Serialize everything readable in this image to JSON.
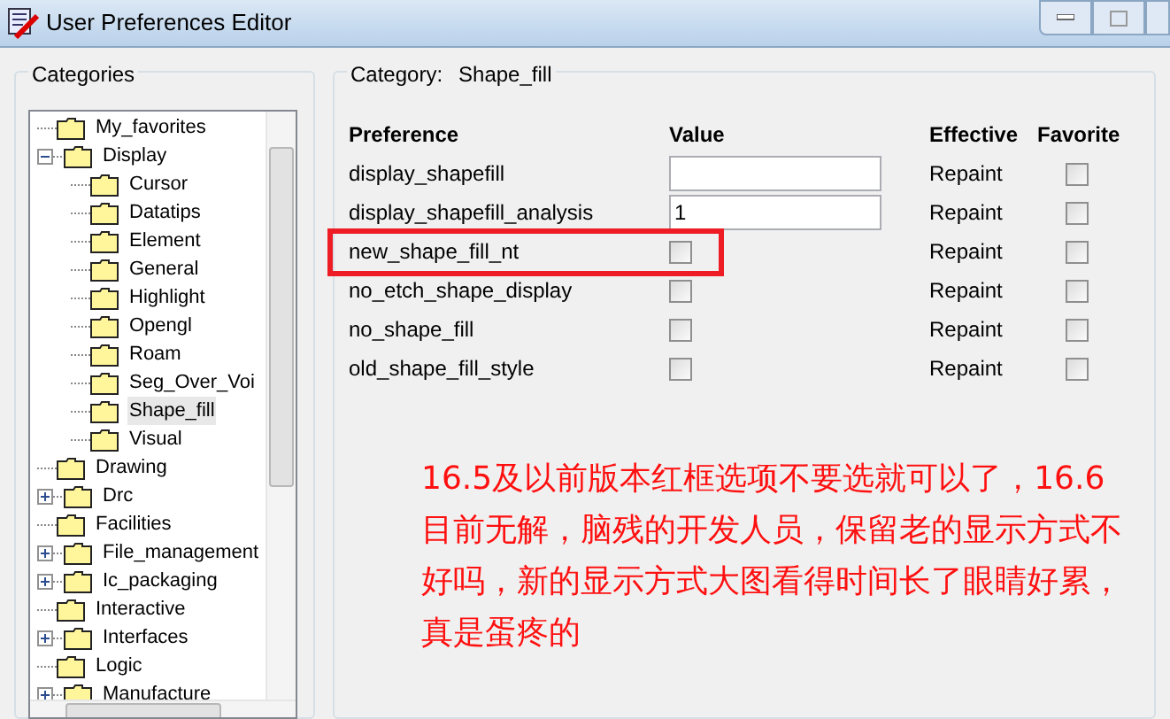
{
  "window": {
    "title": "User Preferences Editor"
  },
  "categories": {
    "title": "Categories",
    "tree": [
      {
        "label": "My_favorites",
        "selected": false
      },
      {
        "label": "Display",
        "selected": false,
        "expanded": true,
        "children": [
          {
            "label": "Cursor",
            "selected": false
          },
          {
            "label": "Datatips",
            "selected": false
          },
          {
            "label": "Element",
            "selected": false
          },
          {
            "label": "General",
            "selected": false
          },
          {
            "label": "Highlight",
            "selected": false
          },
          {
            "label": "Opengl",
            "selected": false
          },
          {
            "label": "Roam",
            "selected": false
          },
          {
            "label": "Seg_Over_Voi",
            "selected": false
          },
          {
            "label": "Shape_fill",
            "selected": true
          },
          {
            "label": "Visual",
            "selected": false
          }
        ]
      },
      {
        "label": "Drawing",
        "selected": false
      },
      {
        "label": "Drc",
        "selected": false,
        "expanded": false
      },
      {
        "label": "Facilities",
        "selected": false
      },
      {
        "label": "File_management",
        "selected": false,
        "expanded": false
      },
      {
        "label": "Ic_packaging",
        "selected": false,
        "expanded": false
      },
      {
        "label": "Interactive",
        "selected": false
      },
      {
        "label": "Interfaces",
        "selected": false,
        "expanded": false
      },
      {
        "label": "Logic",
        "selected": false
      },
      {
        "label": "Manufacture",
        "selected": false,
        "expanded": false
      }
    ]
  },
  "category_panel": {
    "caption": "Category:",
    "name": "Shape_fill",
    "columns": [
      "Preference",
      "Value",
      "Effective",
      "Favorite"
    ],
    "rows": [
      {
        "preference": "display_shapefill",
        "kind": "text",
        "value": "",
        "effective": "Repaint",
        "favorite": false
      },
      {
        "preference": "display_shapefill_analysis",
        "kind": "text",
        "value": "1",
        "effective": "Repaint",
        "favorite": false
      },
      {
        "preference": "new_shape_fill_nt",
        "kind": "checkbox",
        "checked": false,
        "effective": "Repaint",
        "favorite": false,
        "highlighted": true
      },
      {
        "preference": "no_etch_shape_display",
        "kind": "checkbox",
        "checked": false,
        "effective": "Repaint",
        "favorite": false
      },
      {
        "preference": "no_shape_fill",
        "kind": "checkbox",
        "checked": false,
        "effective": "Repaint",
        "favorite": false
      },
      {
        "preference": "old_shape_fill_style",
        "kind": "checkbox",
        "checked": false,
        "effective": "Repaint",
        "favorite": false
      }
    ]
  },
  "annotation": "16.5及以前版本红框选项不要选就可以了，16.6目前无解，脑残的开发人员，保留老的显示方式不好吗，新的显示方式大图看得时间长了眼睛好累，真是蛋疼的"
}
